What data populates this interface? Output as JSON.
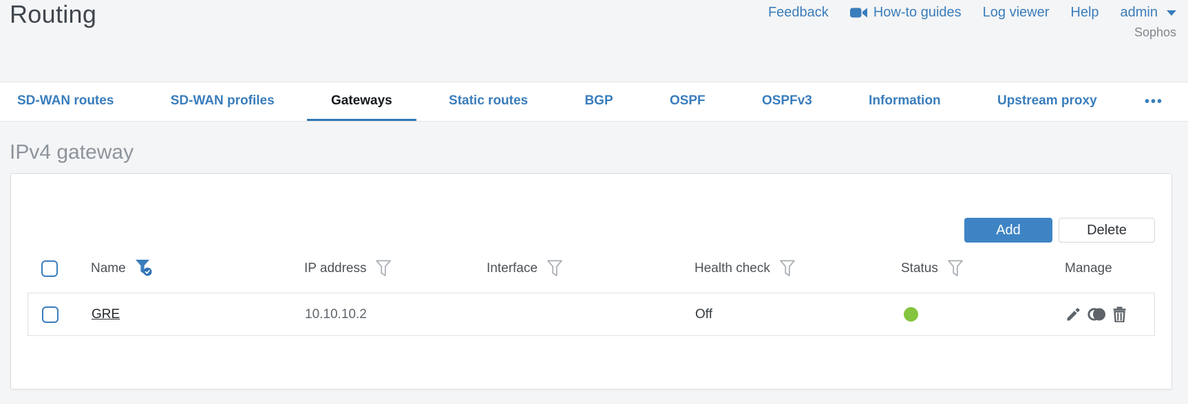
{
  "page": {
    "title": "Routing",
    "brand": "Sophos"
  },
  "top_nav": {
    "feedback": "Feedback",
    "how_to_guides": "How-to guides",
    "log_viewer": "Log viewer",
    "help": "Help",
    "user": "admin"
  },
  "tabs": {
    "items": [
      {
        "label": "SD-WAN routes",
        "active": false
      },
      {
        "label": "SD-WAN profiles",
        "active": false
      },
      {
        "label": "Gateways",
        "active": true
      },
      {
        "label": "Static routes",
        "active": false
      },
      {
        "label": "BGP",
        "active": false
      },
      {
        "label": "OSPF",
        "active": false
      },
      {
        "label": "OSPFv3",
        "active": false
      },
      {
        "label": "Information",
        "active": false
      },
      {
        "label": "Upstream proxy",
        "active": false
      }
    ],
    "more_label": "•••"
  },
  "section": {
    "heading": "IPv4 gateway"
  },
  "toolbar": {
    "add_label": "Add",
    "delete_label": "Delete"
  },
  "table": {
    "columns": [
      {
        "label": "Name",
        "filter": "active"
      },
      {
        "label": "IP address",
        "filter": "default"
      },
      {
        "label": "Interface",
        "filter": "default"
      },
      {
        "label": "Health check",
        "filter": "default"
      },
      {
        "label": "Status",
        "filter": "default"
      },
      {
        "label": "Manage",
        "filter": "none"
      }
    ],
    "rows": [
      {
        "name": "GRE",
        "ip_address": "10.10.10.2",
        "interface": "",
        "health_check": "Off",
        "status": "green"
      }
    ]
  },
  "colors": {
    "accent_blue": "#3a7dbc",
    "button_blue": "#3e84c5",
    "status_green": "#84c43f",
    "active_tab_underline": "#3178b5"
  }
}
